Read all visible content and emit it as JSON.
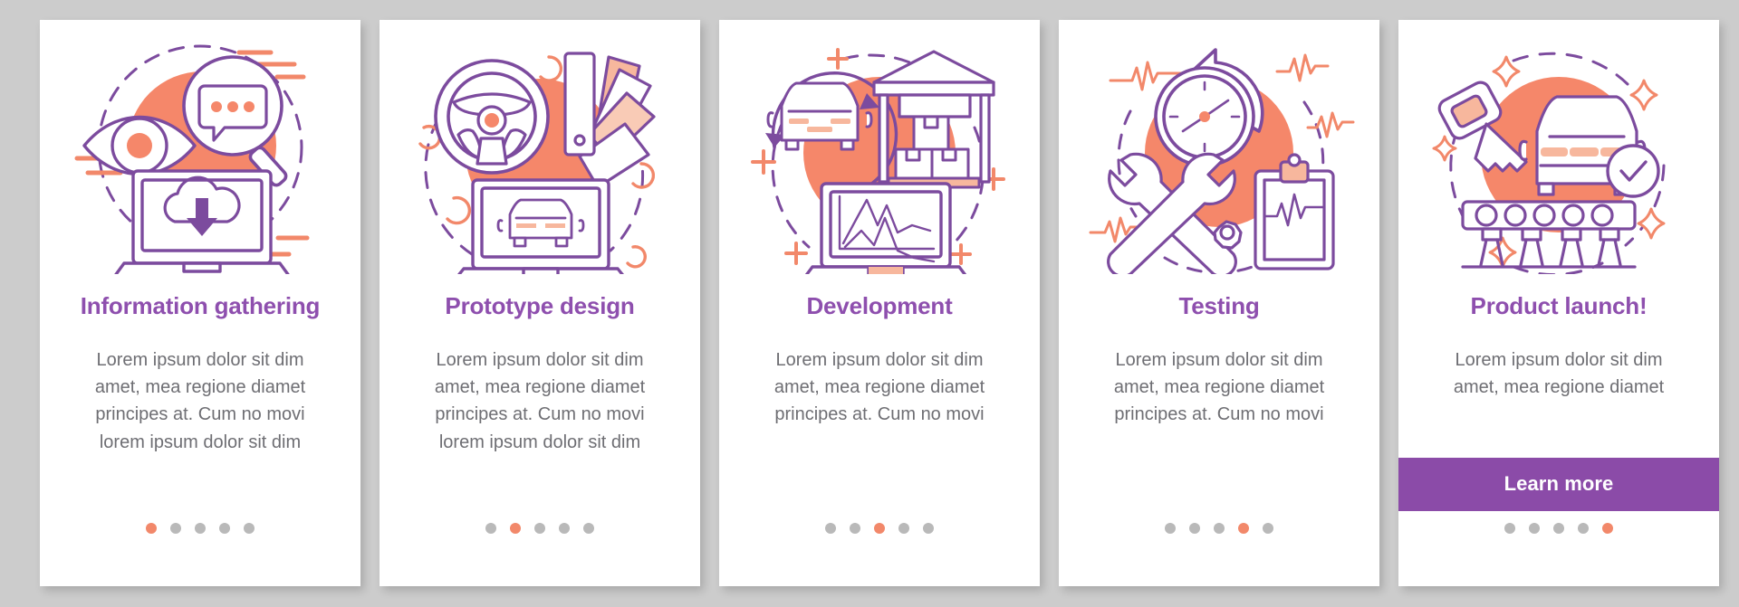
{
  "meta": {
    "background_color": "#cccccc",
    "card_background": "#ffffff",
    "title_color": "#8e4fae",
    "body_color": "#6e6e73",
    "accent_purple": "#8b4ba8",
    "accent_orange": "#f2886a",
    "dot_inactive_color": "#b9b9b9",
    "dot_active_color": "#f2886a"
  },
  "cards": [
    {
      "id": "information-gathering",
      "title": "Information gathering",
      "body": "Lorem ipsum dolor sit dim\namet, mea regione diamet\nprincipes at. Cum no movi\nlorem ipsum dolor sit dim",
      "illustration": "eye-magnifier-laptop-cloud-download-icon",
      "dots_total": 5,
      "dots_active_index": 0,
      "has_button": false,
      "button_label": ""
    },
    {
      "id": "prototype-design",
      "title": "Prototype design",
      "body": "Lorem ipsum dolor sit dim\namet, mea regione diamet\nprincipes at. Cum no movi\nlorem ipsum dolor sit dim",
      "illustration": "steering-wheel-color-swatches-laptop-car-icon",
      "dots_total": 5,
      "dots_active_index": 1,
      "has_button": false,
      "button_label": ""
    },
    {
      "id": "development",
      "title": "Development",
      "body": "Lorem ipsum dolor sit dim\namet, mea regione diamet\nprincipes at. Cum no movi",
      "illustration": "car-warehouse-boxes-laptop-chart-icon",
      "dots_total": 5,
      "dots_active_index": 2,
      "has_button": false,
      "button_label": ""
    },
    {
      "id": "testing",
      "title": "Testing",
      "body": "Lorem ipsum dolor sit dim\namet, mea regione diamet\nprincipes at. Cum no movi",
      "illustration": "clock-wrenches-clipboard-heartbeat-icon",
      "dots_total": 5,
      "dots_active_index": 3,
      "has_button": false,
      "button_label": ""
    },
    {
      "id": "product-launch",
      "title": "Product launch!",
      "body": "Lorem ipsum dolor sit dim\namet, mea regione diamet",
      "illustration": "car-key-conveyor-check-icon",
      "dots_total": 5,
      "dots_active_index": 4,
      "has_button": true,
      "button_label": "Learn more"
    }
  ]
}
